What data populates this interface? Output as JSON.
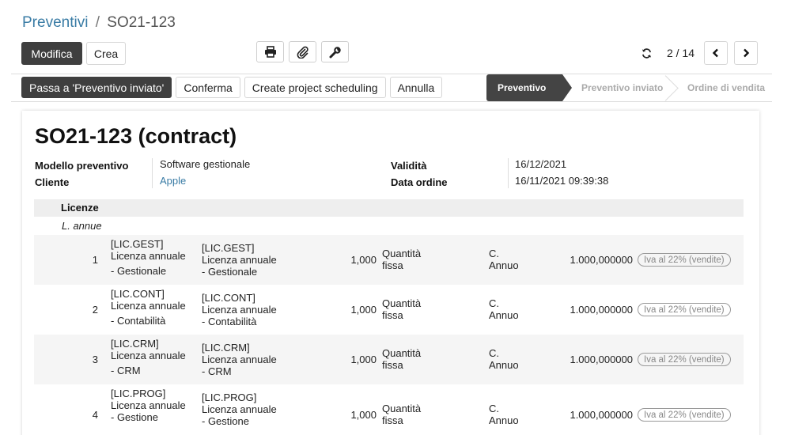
{
  "breadcrumb": {
    "parent": "Preventivi",
    "separator": "/",
    "current": "SO21-123"
  },
  "toolbar": {
    "edit_label": "Modifica",
    "create_label": "Crea",
    "icons": [
      "print-icon",
      "paperclip-icon",
      "wrench-icon"
    ]
  },
  "pager": {
    "counter": "2 / 14",
    "icons": [
      "refresh-icon",
      "chevron-left-icon",
      "chevron-right-icon"
    ]
  },
  "status_actions": [
    "Passa a 'Preventivo inviato'",
    "Conferma",
    "Create project scheduling",
    "Annulla"
  ],
  "stages": [
    {
      "label": "Preventivo",
      "active": true
    },
    {
      "label": "Preventivo inviato",
      "active": false
    },
    {
      "label": "Ordine di vendita",
      "active": false
    }
  ],
  "document": {
    "title": "SO21-123 (contract)",
    "fields_left": [
      {
        "label": "Modello preventivo",
        "value": "Software gestionale"
      },
      {
        "label": "Cliente",
        "value": "Apple"
      }
    ],
    "fields_right": [
      {
        "label": "Validità",
        "value": "16/12/2021"
      },
      {
        "label": "Data ordine",
        "value": "16/11/2021 09:39:38"
      }
    ]
  },
  "lines": {
    "section": "Licenze",
    "subsection": "L. annue",
    "rows": [
      {
        "num": "1",
        "product": [
          "[LIC.GEST]",
          "Licenza annuale",
          "- Gestionale"
        ],
        "description": [
          "[LIC.GEST]",
          "Licenza annuale",
          "- Gestionale"
        ],
        "qty": "1,000",
        "qty_type": [
          "Quantità",
          "fissa"
        ],
        "uom": [
          "C.",
          "Annuo"
        ],
        "price": "1.000,000000",
        "tax": "Iva al 22% (vendite)"
      },
      {
        "num": "2",
        "product": [
          "[LIC.CONT]",
          "Licenza annuale",
          "- Contabilità"
        ],
        "description": [
          "[LIC.CONT]",
          "Licenza annuale",
          "- Contabilità"
        ],
        "qty": "1,000",
        "qty_type": [
          "Quantità",
          "fissa"
        ],
        "uom": [
          "C.",
          "Annuo"
        ],
        "price": "1.000,000000",
        "tax": "Iva al 22% (vendite)"
      },
      {
        "num": "3",
        "product": [
          "[LIC.CRM]",
          "Licenza annuale",
          "- CRM"
        ],
        "description": [
          "[LIC.CRM]",
          "Licenza annuale",
          "- CRM"
        ],
        "qty": "1,000",
        "qty_type": [
          "Quantità",
          "fissa"
        ],
        "uom": [
          "C.",
          "Annuo"
        ],
        "price": "1.000,000000",
        "tax": "Iva al 22% (vendite)"
      },
      {
        "num": "4",
        "product": [
          "[LIC.PROG]",
          "Licenza annuale",
          "- Gestione"
        ],
        "description": [
          "[LIC.PROG]",
          "Licenza annuale",
          "- Gestione"
        ],
        "qty": "1,000",
        "qty_type": [
          "Quantità",
          "fissa"
        ],
        "uom": [
          "C.",
          "Annuo"
        ],
        "price": "1.000,000000",
        "tax": "Iva al 22% (vendite)"
      }
    ]
  }
}
